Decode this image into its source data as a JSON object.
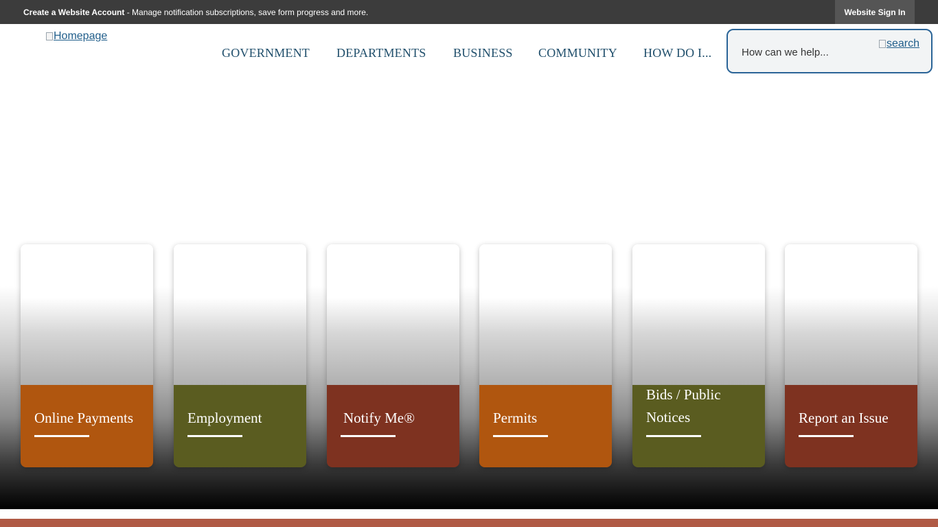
{
  "topbar": {
    "create_account": "Create a Website Account",
    "message": " - Manage notification subscriptions, save form progress and more.",
    "sign_in": "Website Sign In"
  },
  "header": {
    "logo_alt": "Homepage",
    "nav": [
      "GOVERNMENT",
      "DEPARTMENTS",
      "BUSINESS",
      "COMMUNITY",
      "HOW DO I..."
    ],
    "search_placeholder": "How can we help...",
    "search_button_alt": "search"
  },
  "cards": [
    {
      "label": "Online Payments",
      "color": "#b0560f"
    },
    {
      "label": "Employment",
      "color": "#5a5c20"
    },
    {
      "label": "Notify Me®",
      "color": "#7e3220"
    },
    {
      "label": "Permits",
      "color": "#b0560f"
    },
    {
      "label": "Bids / Public Notices",
      "color": "#5a5c20"
    },
    {
      "label": "Report an Issue",
      "color": "#7e3220"
    }
  ],
  "colors": {
    "topbar_bg": "#3c3c3c",
    "nav_text": "#1f4e6b",
    "search_border": "#2a6497",
    "footer_strip": "#b05a45"
  }
}
